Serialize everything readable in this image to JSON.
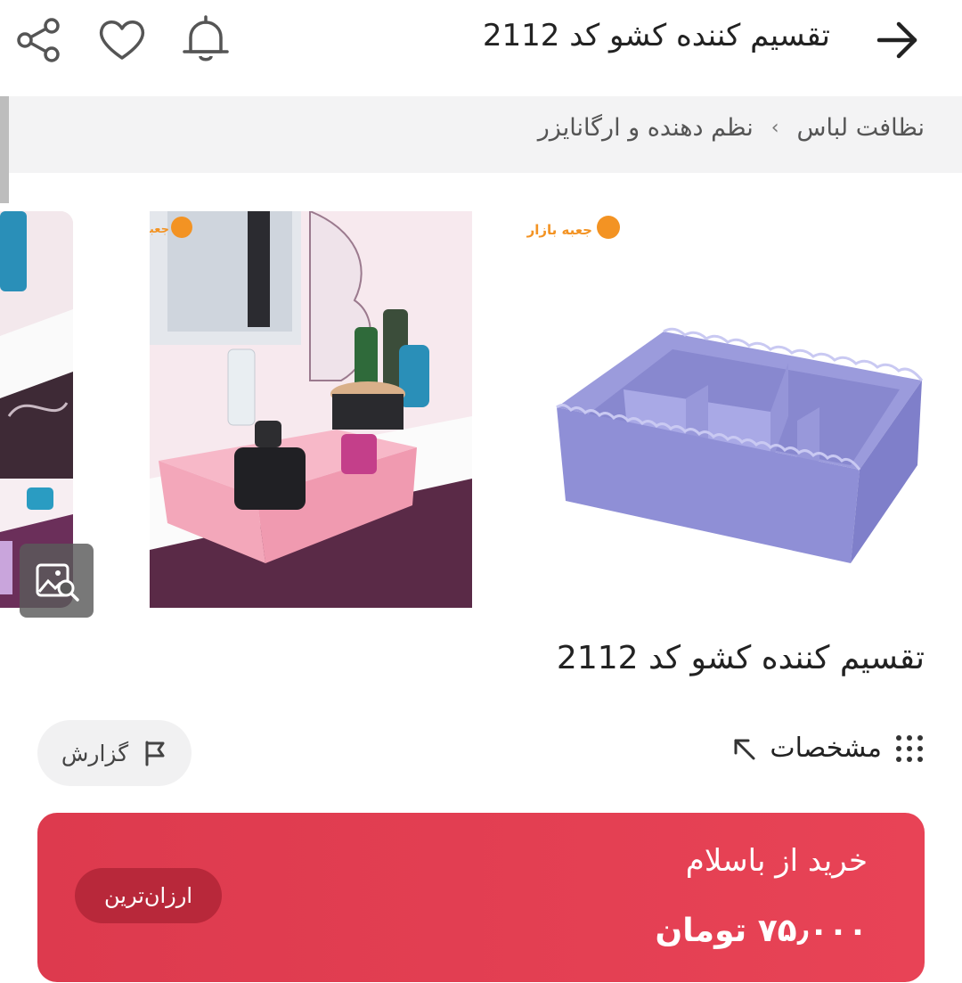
{
  "header": {
    "title": "تقسیم کننده کشو کد 2112",
    "icons": [
      "arrow-right-icon",
      "bell-icon",
      "heart-icon",
      "share-icon"
    ]
  },
  "breadcrumb": {
    "items": [
      "نظافت لباس",
      "نظم دهنده و ارگانایزر"
    ],
    "separator": "›"
  },
  "gallery": {
    "watermark": "جعبه بازار",
    "images": [
      "purple-organizer",
      "pink-organizer-on-vanity",
      "vanity-partial"
    ]
  },
  "product": {
    "title": "تقسیم کننده کشو کد 2112"
  },
  "actions": {
    "specs_label": "مشخصات",
    "report_label": "گزارش"
  },
  "buy": {
    "title": "خرید از باسلام",
    "price": "۷۵٫۰۰۰ تومان",
    "badge": "ارزان‌ترین",
    "color": "#e2404f"
  }
}
